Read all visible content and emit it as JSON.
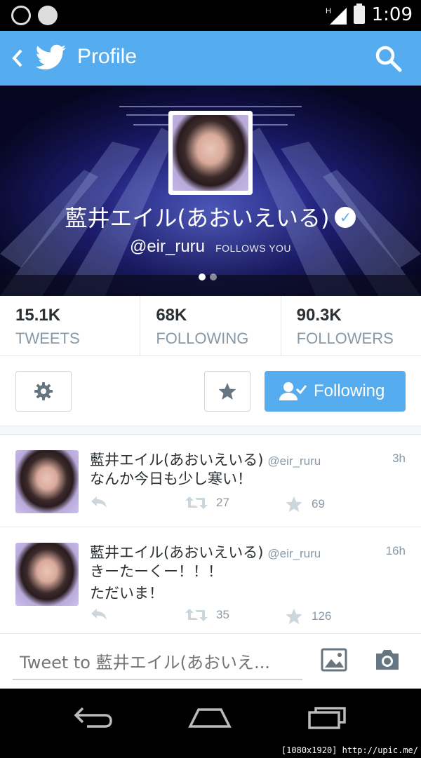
{
  "status_bar": {
    "time": "1:09",
    "network": "H"
  },
  "app_bar": {
    "title": "Profile"
  },
  "profile": {
    "name": "藍井エイル(あおいえいる)",
    "handle": "@eir_ruru",
    "follows_you": "FOLLOWS YOU",
    "verified": true
  },
  "stats": [
    {
      "value": "15.1K",
      "label": "TWEETS"
    },
    {
      "value": "68K",
      "label": "FOLLOWING"
    },
    {
      "value": "90.3K",
      "label": "FOLLOWERS"
    }
  ],
  "actions": {
    "following_label": "Following"
  },
  "tweets": [
    {
      "name": "藍井エイル(あおいえいる)",
      "handle": "@eir_ruru",
      "time": "3h",
      "text": "なんか今日も少し寒い！",
      "retweets": "27",
      "favorites": "69"
    },
    {
      "name": "藍井エイル(あおいえいる)",
      "handle": "@eir_ruru",
      "time": "16h",
      "text": "きーたーくー！！！\nただいま！",
      "retweets": "35",
      "favorites": "126"
    }
  ],
  "composer": {
    "placeholder": "Tweet to 藍井エイル(あおいえ..."
  },
  "watermark": "[1080x1920] http://upic.me/",
  "colors": {
    "accent": "#55acee",
    "text": "#292f33",
    "muted": "#8899a6"
  },
  "icons": [
    "back-icon",
    "twitter-bird-icon",
    "search-icon",
    "verified-icon",
    "gear-icon",
    "star-icon",
    "follow-check-icon",
    "reply-icon",
    "retweet-icon",
    "favorite-icon",
    "image-icon",
    "camera-icon"
  ]
}
